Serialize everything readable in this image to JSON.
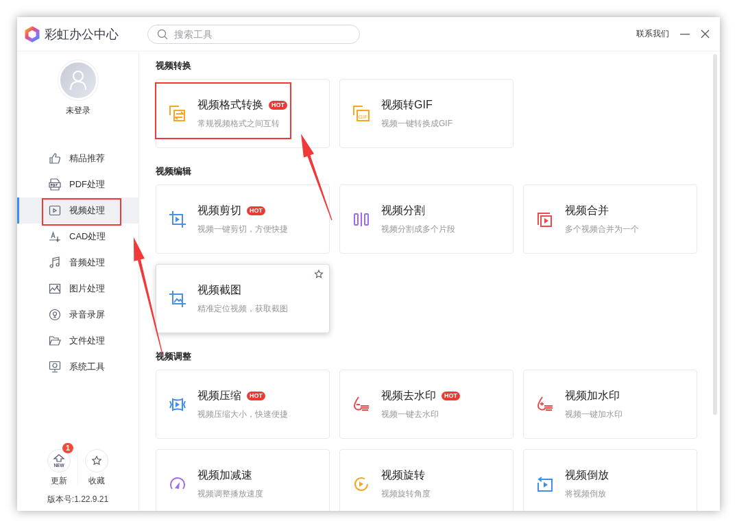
{
  "app": {
    "title": "彩虹办公中心"
  },
  "search": {
    "placeholder": "搜索工具"
  },
  "contact": "联系我们",
  "user": {
    "name": "未登录"
  },
  "nav": [
    {
      "label": "精品推荐",
      "kind": "thumb",
      "selected": false,
      "highlighted": false
    },
    {
      "label": "PDF处理",
      "kind": "pdf",
      "selected": false,
      "highlighted": false
    },
    {
      "label": "视频处理",
      "kind": "video",
      "selected": true,
      "highlighted": true
    },
    {
      "label": "CAD处理",
      "kind": "cad",
      "selected": false,
      "highlighted": false
    },
    {
      "label": "音频处理",
      "kind": "music",
      "selected": false,
      "highlighted": false
    },
    {
      "label": "图片处理",
      "kind": "image",
      "selected": false,
      "highlighted": false
    },
    {
      "label": "录音录屏",
      "kind": "mic",
      "selected": false,
      "highlighted": false
    },
    {
      "label": "文件处理",
      "kind": "folder",
      "selected": false,
      "highlighted": false
    },
    {
      "label": "系统工具",
      "kind": "system",
      "selected": false,
      "highlighted": false
    }
  ],
  "footer": {
    "buttons": [
      {
        "label": "更新",
        "kind": "new",
        "icon_text": "NEW",
        "badge": "1"
      },
      {
        "label": "收藏",
        "kind": "star"
      }
    ],
    "version": "版本号:1.22.9.21"
  },
  "sections": [
    {
      "title": "视频转换",
      "cards": [
        {
          "title": "视频格式转换",
          "desc": "常规视频格式之间互转",
          "badge": "HOT",
          "hovered": false,
          "highlighted": true,
          "kind": "convert",
          "color": "#f5a623"
        },
        {
          "title": "视频转GIF",
          "desc": "视频一键转换成GIF",
          "hovered": false,
          "highlighted": false,
          "kind": "gif",
          "icon_text": "GIF",
          "color": "#f5a623"
        }
      ]
    },
    {
      "title": "视频编辑",
      "cards": [
        {
          "title": "视频剪切",
          "desc": "视频一键剪切，方便快捷",
          "badge": "HOT",
          "hovered": false,
          "highlighted": false,
          "kind": "crop",
          "color": "#4a90e2"
        },
        {
          "title": "视频分割",
          "desc": "视频分割成多个片段",
          "hovered": false,
          "highlighted": false,
          "kind": "split",
          "color": "#9b6cf0"
        },
        {
          "title": "视频合并",
          "desc": "多个视频合并为一个",
          "hovered": false,
          "highlighted": false,
          "kind": "merge",
          "color": "#e94b4b"
        },
        {
          "title": "视频截图",
          "desc": "精准定位视频，获取截图",
          "hovered": true,
          "highlighted": false,
          "kind": "screenshot",
          "color": "#4a90e2"
        }
      ]
    },
    {
      "title": "视频调整",
      "cards": [
        {
          "title": "视频压缩",
          "desc": "视频压缩大小，快速便捷",
          "badge": "HOT",
          "hovered": false,
          "highlighted": false,
          "kind": "compress",
          "color": "#3d8ef0"
        },
        {
          "title": "视频去水印",
          "desc": "视频一键去水印",
          "badge": "HOT",
          "hovered": false,
          "highlighted": false,
          "kind": "unmark",
          "color": "#e94b4b"
        },
        {
          "title": "视频加水印",
          "desc": "视频一键加水印",
          "hovered": false,
          "highlighted": false,
          "kind": "addmark",
          "color": "#e94b4b"
        },
        {
          "title": "视频加减速",
          "desc": "视频调整播放速度",
          "hovered": false,
          "highlighted": false,
          "kind": "speed",
          "color": "#9b6cf0"
        },
        {
          "title": "视频旋转",
          "desc": "视频旋转角度",
          "hovered": false,
          "highlighted": false,
          "kind": "rotate",
          "color": "#f5a623"
        },
        {
          "title": "视频倒放",
          "desc": "将视频倒放",
          "hovered": false,
          "highlighted": false,
          "kind": "reverse",
          "color": "#3d8ef0"
        }
      ]
    }
  ]
}
